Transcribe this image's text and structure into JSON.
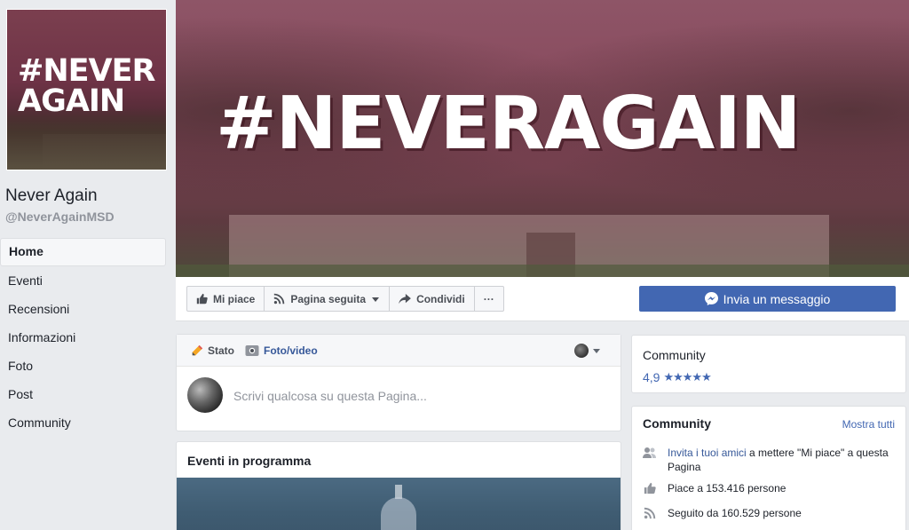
{
  "page": {
    "name": "Never Again",
    "handle": "@NeverAgainMSD",
    "profile_text_line1": "#NEVER",
    "profile_text_line2": "AGAIN",
    "cover_text": "#NEVERAGAIN"
  },
  "nav": {
    "items": [
      {
        "label": "Home",
        "active": true
      },
      {
        "label": "Eventi"
      },
      {
        "label": "Recensioni"
      },
      {
        "label": "Informazioni"
      },
      {
        "label": "Foto"
      },
      {
        "label": "Post"
      },
      {
        "label": "Community"
      }
    ]
  },
  "actions": {
    "like": "Mi piace",
    "follow": "Pagina seguita",
    "share": "Condividi",
    "more": "···",
    "message": "Invia un messaggio"
  },
  "composer": {
    "tab_status": "Stato",
    "tab_photo": "Foto/video",
    "placeholder": "Scrivi qualcosa su questa Pagina..."
  },
  "events": {
    "title": "Eventi in programma"
  },
  "rating": {
    "title": "Community",
    "value": "4,9",
    "stars": "★★★★★"
  },
  "community": {
    "title": "Community",
    "see_all": "Mostra tutti",
    "invite_link": "Invita i tuoi amici",
    "invite_rest": " a mettere \"Mi piace\" a questa Pagina",
    "likes": "Piace a 153.416 persone",
    "follows": "Seguito da 160.529 persone"
  },
  "colors": {
    "brand_blue": "#4267b2",
    "link_blue": "#365899",
    "background": "#e9ebee"
  }
}
